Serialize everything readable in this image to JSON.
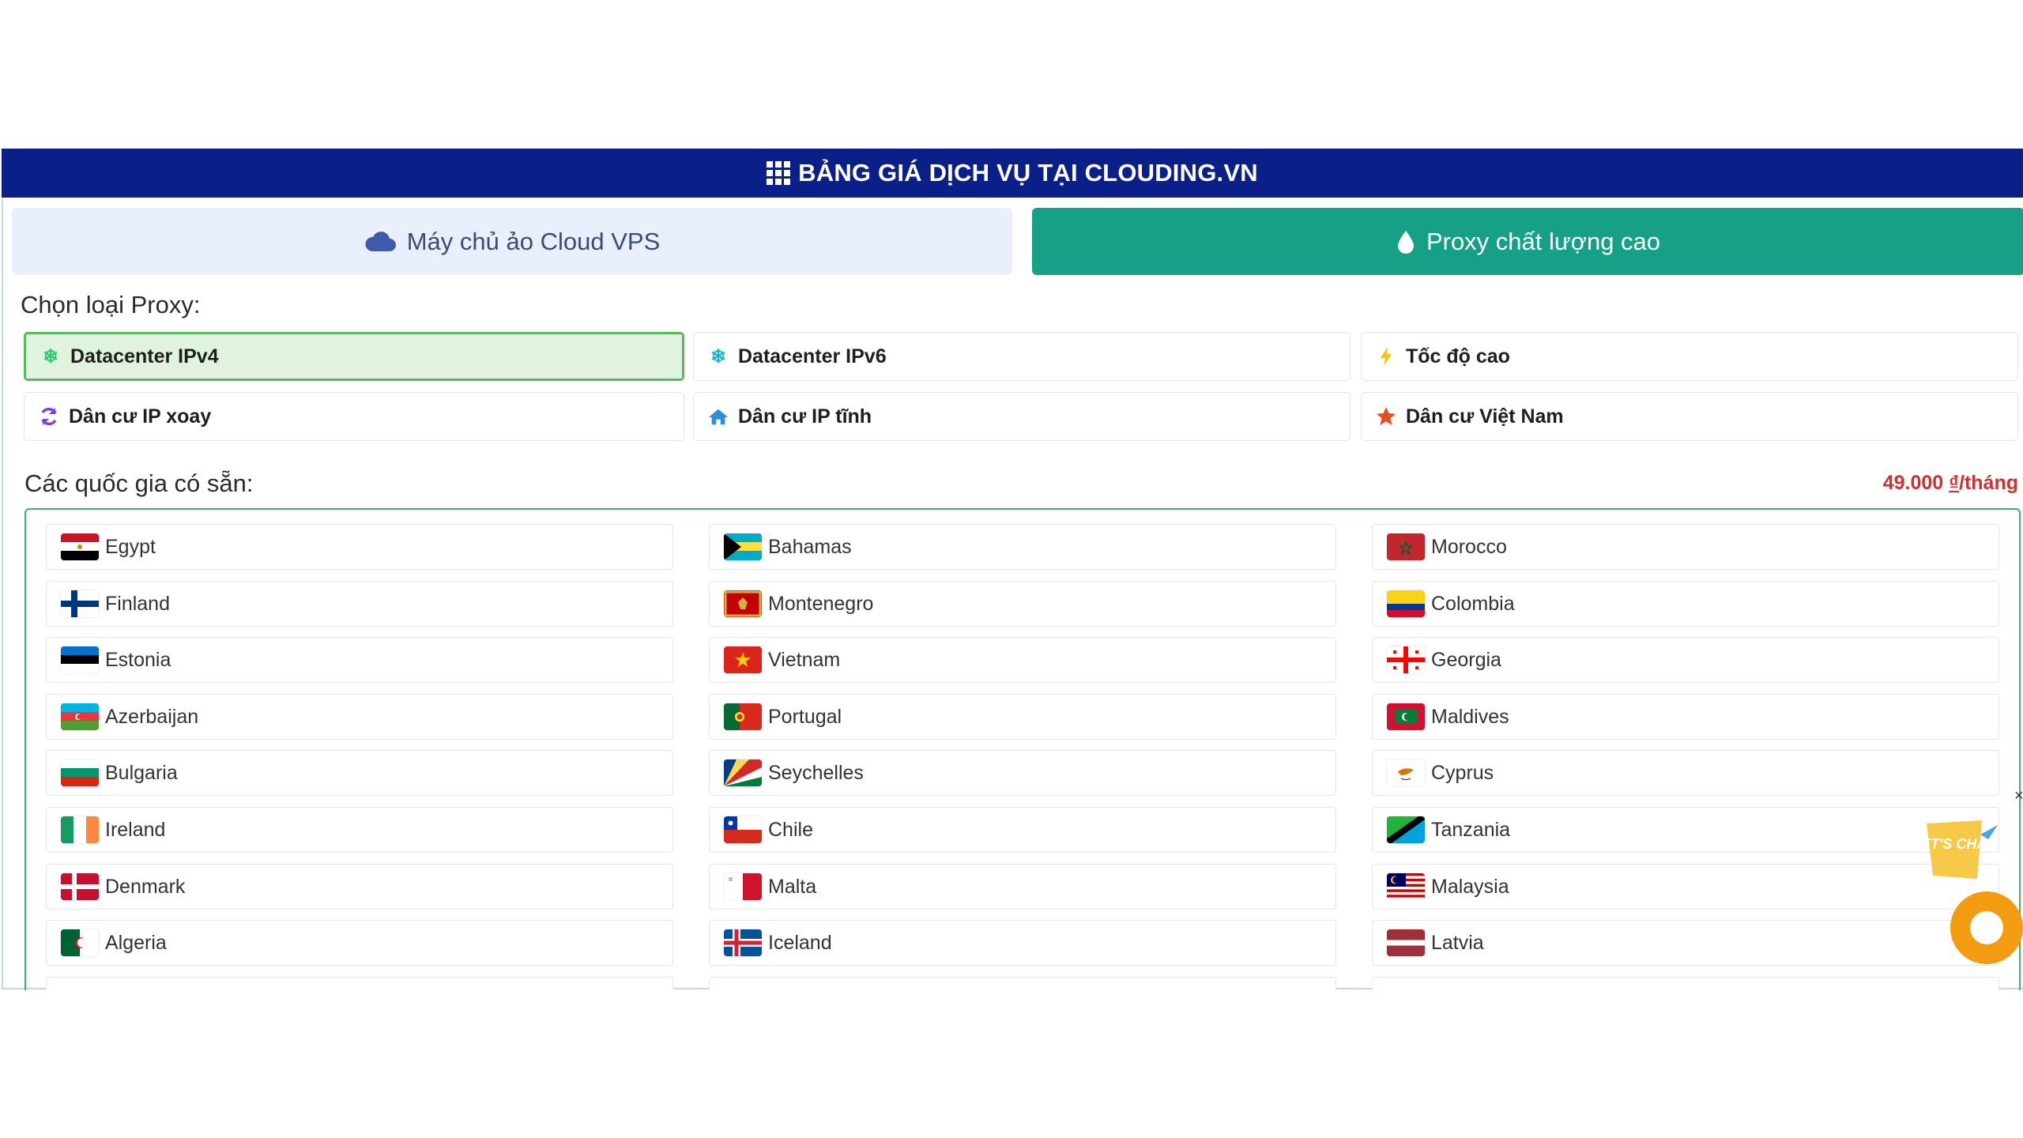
{
  "header": {
    "title": "BẢNG GIÁ DỊCH VỤ TẠI CLOUDING.VN",
    "icon": "grid-icon"
  },
  "tabs": [
    {
      "label": "Máy chủ ảo Cloud VPS",
      "icon": "cloud-icon",
      "active": false
    },
    {
      "label": "Proxy chất lượng cao",
      "icon": "droplet-icon",
      "active": true
    }
  ],
  "proxy_section": {
    "label": "Chọn loại Proxy:"
  },
  "proxy_types": [
    {
      "label": "Datacenter IPv4",
      "icon": "snowflake-icon",
      "active": true
    },
    {
      "label": "Datacenter IPv6",
      "icon": "snowflake-icon",
      "active": false
    },
    {
      "label": "Tốc độ cao",
      "icon": "bolt-icon",
      "active": false
    },
    {
      "label": "Dân cư IP xoay",
      "icon": "rotate-icon",
      "active": false
    },
    {
      "label": "Dân cư IP tĩnh",
      "icon": "home-icon",
      "active": false
    },
    {
      "label": "Dân cư Việt Nam",
      "icon": "star-icon",
      "active": false
    }
  ],
  "countries_section": {
    "label": "Các quốc gia có sẵn:"
  },
  "price": {
    "amount": "49.000",
    "currency": "₫",
    "unit": "/tháng"
  },
  "countries": [
    {
      "name": "Egypt",
      "flag": "egypt-flag"
    },
    {
      "name": "Bahamas",
      "flag": "bahamas-flag"
    },
    {
      "name": "Morocco",
      "flag": "morocco-flag"
    },
    {
      "name": "Finland",
      "flag": "finland-flag"
    },
    {
      "name": "Montenegro",
      "flag": "montenegro-flag"
    },
    {
      "name": "Colombia",
      "flag": "colombia-flag"
    },
    {
      "name": "Estonia",
      "flag": "estonia-flag"
    },
    {
      "name": "Vietnam",
      "flag": "vietnam-flag"
    },
    {
      "name": "Georgia",
      "flag": "georgia-flag"
    },
    {
      "name": "Azerbaijan",
      "flag": "azerbaijan-flag"
    },
    {
      "name": "Portugal",
      "flag": "portugal-flag"
    },
    {
      "name": "Maldives",
      "flag": "maldives-flag"
    },
    {
      "name": "Bulgaria",
      "flag": "bulgaria-flag"
    },
    {
      "name": "Seychelles",
      "flag": "seychelles-flag"
    },
    {
      "name": "Cyprus",
      "flag": "cyprus-flag"
    },
    {
      "name": "Ireland",
      "flag": "ireland-flag"
    },
    {
      "name": "Chile",
      "flag": "chile-flag"
    },
    {
      "name": "Tanzania",
      "flag": "tanzania-flag"
    },
    {
      "name": "Denmark",
      "flag": "denmark-flag"
    },
    {
      "name": "Malta",
      "flag": "malta-flag"
    },
    {
      "name": "Malaysia",
      "flag": "malaysia-flag"
    },
    {
      "name": "Algeria",
      "flag": "algeria-flag"
    },
    {
      "name": "Iceland",
      "flag": "iceland-flag"
    },
    {
      "name": "Latvia",
      "flag": "latvia-flag"
    }
  ],
  "chat_widget": {
    "label": "LET'S CHAT",
    "close": "×"
  },
  "colors": {
    "header_bg": "#0a1f87",
    "proxy_tab_bg": "#16a085",
    "vps_tab_bg": "#e9f0fb",
    "active_type_bg": "#dff3df",
    "active_type_border": "#5cb85c",
    "price": "#d32f2f",
    "chat": "#f39c12"
  }
}
